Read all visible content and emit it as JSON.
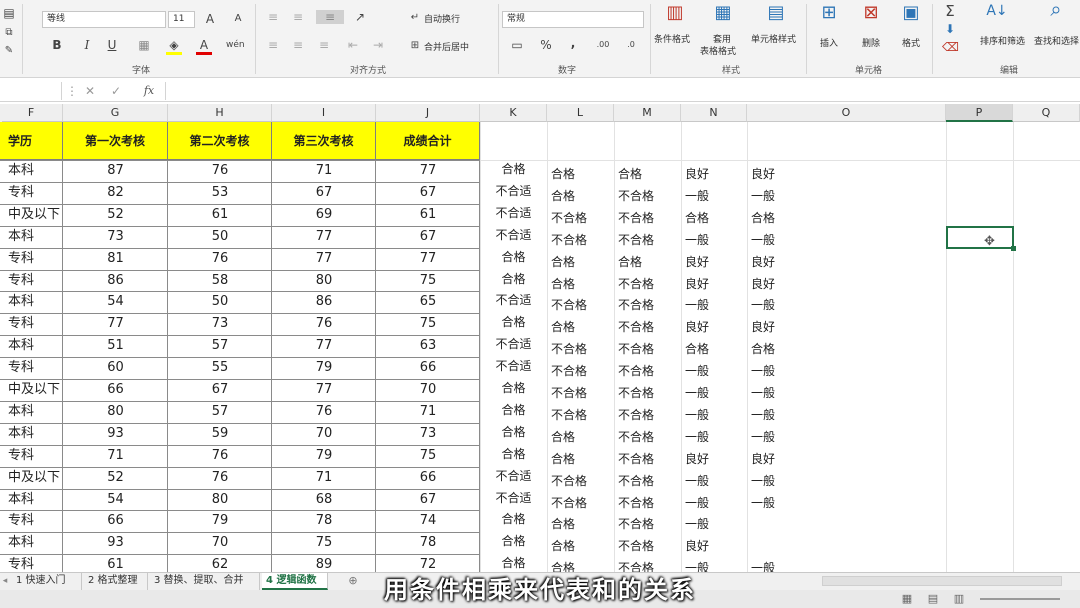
{
  "ribbon": {
    "font_name": "等线",
    "font_size": "11",
    "wrap_text": "自动换行",
    "merge_center": "合并后居中",
    "number_format": "常规",
    "percent": "%",
    "comma": ",",
    "cond_format": "条件格式",
    "table_format_1": "套用",
    "table_format_2": "表格格式",
    "cell_style": "单元格样式",
    "insert": "插入",
    "delete": "删除",
    "format": "格式",
    "sort_filter": "排序和筛选",
    "find_select": "查找和选择",
    "groups": {
      "font": "字体",
      "align": "对齐方式",
      "number": "数字",
      "style": "样式",
      "cells": "单元格",
      "edit": "编辑"
    },
    "bold": "B",
    "italic": "I",
    "underline": "U",
    "font_color": "A"
  },
  "formula_bar": {
    "fx": "fx"
  },
  "columns": [
    {
      "name": "F"
    },
    {
      "name": "G"
    },
    {
      "name": "H"
    },
    {
      "name": "I"
    },
    {
      "name": "J"
    },
    {
      "name": "K"
    },
    {
      "name": "L"
    },
    {
      "name": "M"
    },
    {
      "name": "N"
    },
    {
      "name": "O"
    },
    {
      "name": "P"
    },
    {
      "name": "Q"
    }
  ],
  "headers": [
    "学历",
    "第一次考核",
    "第二次考核",
    "第三次考核",
    "成绩合计"
  ],
  "rows": [
    [
      "本科",
      "87",
      "76",
      "71",
      "77",
      "合格",
      "合格",
      "合格",
      "良好",
      "良好"
    ],
    [
      "专科",
      "82",
      "53",
      "67",
      "67",
      "不合适",
      "合格",
      "不合格",
      "一般",
      "一般"
    ],
    [
      "中及以下",
      "52",
      "61",
      "69",
      "61",
      "不合适",
      "不合格",
      "不合格",
      "合格",
      "合格"
    ],
    [
      "本科",
      "73",
      "50",
      "77",
      "67",
      "不合适",
      "不合格",
      "不合格",
      "一般",
      "一般"
    ],
    [
      "专科",
      "81",
      "76",
      "77",
      "77",
      "合格",
      "合格",
      "合格",
      "良好",
      "良好"
    ],
    [
      "专科",
      "86",
      "58",
      "80",
      "75",
      "合格",
      "合格",
      "不合格",
      "良好",
      "良好"
    ],
    [
      "本科",
      "54",
      "50",
      "86",
      "65",
      "不合适",
      "不合格",
      "不合格",
      "一般",
      "一般"
    ],
    [
      "专科",
      "77",
      "73",
      "76",
      "75",
      "合格",
      "合格",
      "不合格",
      "良好",
      "良好"
    ],
    [
      "本科",
      "51",
      "57",
      "77",
      "63",
      "不合适",
      "不合格",
      "不合格",
      "合格",
      "合格"
    ],
    [
      "专科",
      "60",
      "55",
      "79",
      "66",
      "不合适",
      "不合格",
      "不合格",
      "一般",
      "一般"
    ],
    [
      "中及以下",
      "66",
      "67",
      "77",
      "70",
      "合格",
      "不合格",
      "不合格",
      "一般",
      "一般"
    ],
    [
      "本科",
      "80",
      "57",
      "76",
      "71",
      "合格",
      "不合格",
      "不合格",
      "一般",
      "一般"
    ],
    [
      "本科",
      "93",
      "59",
      "70",
      "73",
      "合格",
      "合格",
      "不合格",
      "一般",
      "一般"
    ],
    [
      "专科",
      "71",
      "76",
      "79",
      "75",
      "合格",
      "合格",
      "不合格",
      "良好",
      "良好"
    ],
    [
      "中及以下",
      "52",
      "76",
      "71",
      "66",
      "不合适",
      "不合格",
      "不合格",
      "一般",
      "一般"
    ],
    [
      "本科",
      "54",
      "80",
      "68",
      "67",
      "不合适",
      "不合格",
      "不合格",
      "一般",
      "一般"
    ],
    [
      "专科",
      "66",
      "79",
      "78",
      "74",
      "合格",
      "合格",
      "不合格",
      "一般",
      ""
    ],
    [
      "本科",
      "93",
      "70",
      "75",
      "78",
      "合格",
      "合格",
      "不合格",
      "良好",
      ""
    ],
    [
      "专科",
      "61",
      "62",
      "89",
      "72",
      "合格",
      "合格",
      "不合格",
      "一般",
      "一般"
    ]
  ],
  "sheet_tabs": [
    {
      "label": "1 快速入门"
    },
    {
      "label": "2 格式整理"
    },
    {
      "label": "3 替换、提取、合并"
    },
    {
      "label": "4 逻辑函数"
    }
  ],
  "subtitle": "用条件相乘来代表和的关系"
}
